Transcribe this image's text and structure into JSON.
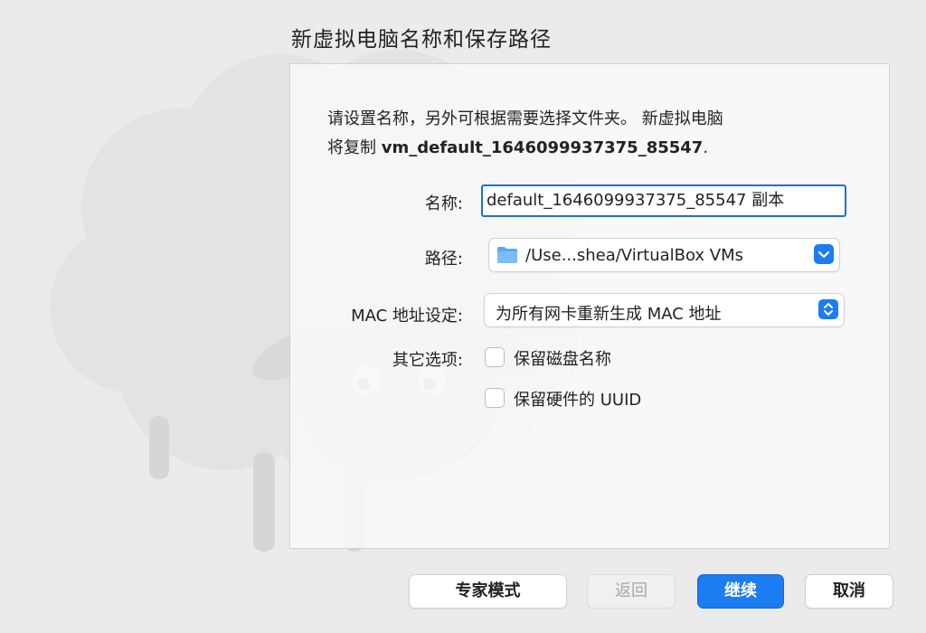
{
  "dialog": {
    "title": "新虚拟电脑名称和保存路径",
    "description_line1": "请设置名称，另外可根据需要选择文件夹。 新虚拟电脑",
    "description_line2_prefix": "将复制 ",
    "description_line2_vm": "vm_default_1646099937375_85547",
    "description_line2_suffix": "."
  },
  "form": {
    "name_label": "名称:",
    "name_value": "default_1646099937375_85547 副本",
    "path_label": "路径:",
    "path_value": "/Use...shea/VirtualBox VMs",
    "mac_label": "MAC 地址设定:",
    "mac_value": "为所有网卡重新生成 MAC 地址",
    "other_label": "其它选项:",
    "option_keep_disk_names": "保留磁盘名称",
    "option_keep_hw_uuid": "保留硬件的 UUID"
  },
  "buttons": {
    "expert": "专家模式",
    "back": "返回",
    "continue": "继续",
    "cancel": "取消"
  },
  "colors": {
    "accent": "#1c7cf2",
    "panel_border": "#d2d2d2"
  },
  "icons": {
    "folder": "folder-icon",
    "path_chevron": "chevron-down-icon",
    "mac_chevron": "updown-chevron-icon",
    "mascot": "sheep-icon"
  }
}
